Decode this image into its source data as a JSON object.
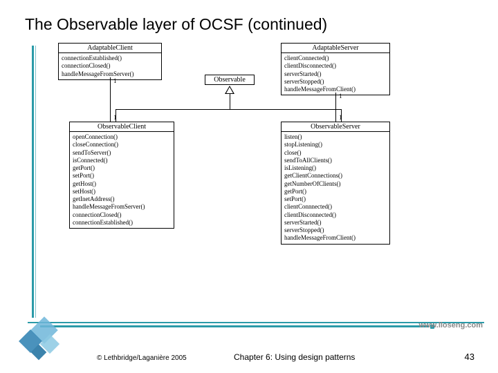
{
  "title": "The Observable layer of OCSF (continued)",
  "footer": {
    "copyright": "© Lethbridge/Laganière 2005",
    "chapter": "Chapter 6: Using design patterns",
    "page": "43",
    "url": "www.lloseng.com"
  },
  "boxes": {
    "adaptableClient": {
      "name": "AdaptableClient",
      "methods": [
        "connectionEstablished()",
        "connectionClosed()",
        "handleMessageFromServer()"
      ]
    },
    "adaptableServer": {
      "name": "AdaptableServer",
      "methods": [
        "clientConnected()",
        "clientDisconnected()",
        "serverStarted()",
        "serverStopped()",
        "handleMessageFromClient()"
      ]
    },
    "observable": {
      "name": "Observable"
    },
    "observableClient": {
      "name": "ObservableClient",
      "methods": [
        "openConnection()",
        "closeConnection()",
        "sendToServer()",
        "isConnected()",
        "getPort()",
        "setPort()",
        "getHost()",
        "setHost()",
        "getInetAddress()",
        "handleMessageFromServer()",
        "connectionClosed()",
        "connectionEstablished()"
      ]
    },
    "observableServer": {
      "name": "ObservableServer",
      "methods": [
        "listen()",
        "stopListening()",
        "close()",
        "sendToAllClients()",
        "isListening()",
        "getClientConnections()",
        "getNumberOfClients()",
        "getPort()",
        "setPort()",
        "clientConnnected()",
        "clientDisconnected()",
        "serverStarted()",
        "serverStopped()",
        "handleMessageFromClient()"
      ]
    }
  },
  "multiplicities": {
    "adaptableClientBottom": "1",
    "observableClientTop": "1",
    "adaptableServerBottom": "1",
    "observableServerTop": "1"
  }
}
